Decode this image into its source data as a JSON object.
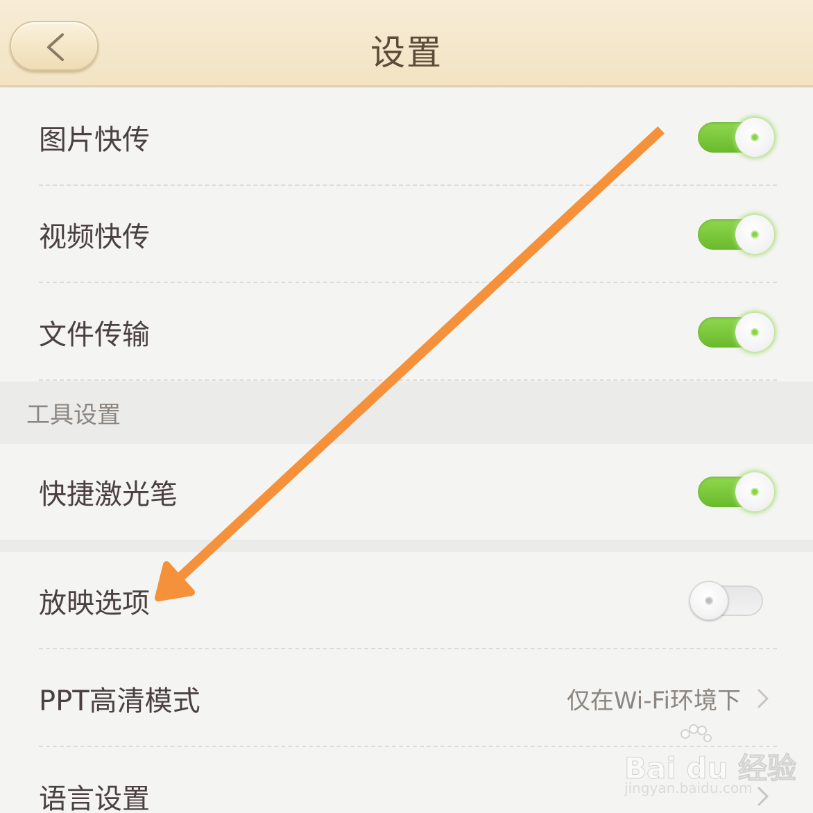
{
  "header": {
    "title": "设置",
    "back_icon": "chevron-left-icon"
  },
  "colors": {
    "header_bg": "#f2e3c3",
    "toggle_on": "#7cc83c",
    "arrow": "#f5913a",
    "section_bg": "#ebebea"
  },
  "rows_top": [
    {
      "label": "图片快传",
      "toggle": true
    },
    {
      "label": "视频快传",
      "toggle": true
    },
    {
      "label": "文件传输",
      "toggle": true
    }
  ],
  "section_tools": {
    "label": "工具设置"
  },
  "row_laser": {
    "label": "快捷激光笔",
    "toggle": true
  },
  "row_projection": {
    "label": "放映选项",
    "toggle": false
  },
  "row_ppt": {
    "label": "PPT高清模式",
    "value": "仅在Wi-Fi环境下"
  },
  "row_language": {
    "label": "语言设置"
  },
  "watermark": {
    "brand": "Bai du 经验",
    "url": "jingyan.baidu.com"
  }
}
